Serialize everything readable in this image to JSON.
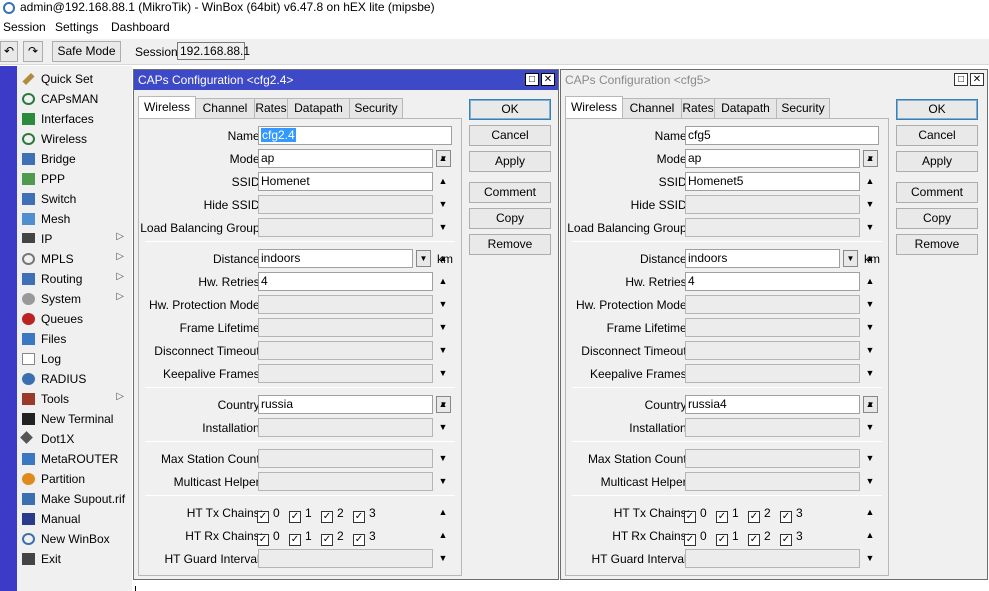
{
  "window_title": "admin@192.168.88.1 (MikroTik) - WinBox (64bit) v6.47.8 on hEX lite (mipsbe)",
  "menu": [
    "Session",
    "Settings",
    "Dashboard"
  ],
  "toolbar": {
    "undo_icon": "undo-icon",
    "redo_icon": "redo-icon",
    "safe_mode": "Safe Mode",
    "session_label": "Session:",
    "session_value": "192.168.88.1"
  },
  "sidebar": [
    {
      "label": "Quick Set",
      "icon": "quick-set-icon",
      "arrow": false
    },
    {
      "label": "CAPsMAN",
      "icon": "capsman-icon",
      "arrow": false
    },
    {
      "label": "Interfaces",
      "icon": "interfaces-icon",
      "arrow": false
    },
    {
      "label": "Wireless",
      "icon": "wireless-icon",
      "arrow": false
    },
    {
      "label": "Bridge",
      "icon": "bridge-icon",
      "arrow": false
    },
    {
      "label": "PPP",
      "icon": "ppp-icon",
      "arrow": false
    },
    {
      "label": "Switch",
      "icon": "switch-icon",
      "arrow": false
    },
    {
      "label": "Mesh",
      "icon": "mesh-icon",
      "arrow": false
    },
    {
      "label": "IP",
      "icon": "ip-icon",
      "arrow": true
    },
    {
      "label": "MPLS",
      "icon": "mpls-icon",
      "arrow": true
    },
    {
      "label": "Routing",
      "icon": "routing-icon",
      "arrow": true
    },
    {
      "label": "System",
      "icon": "system-icon",
      "arrow": true
    },
    {
      "label": "Queues",
      "icon": "queues-icon",
      "arrow": false
    },
    {
      "label": "Files",
      "icon": "files-icon",
      "arrow": false
    },
    {
      "label": "Log",
      "icon": "log-icon",
      "arrow": false
    },
    {
      "label": "RADIUS",
      "icon": "radius-icon",
      "arrow": false
    },
    {
      "label": "Tools",
      "icon": "tools-icon",
      "arrow": true
    },
    {
      "label": "New Terminal",
      "icon": "terminal-icon",
      "arrow": false
    },
    {
      "label": "Dot1X",
      "icon": "dot1x-icon",
      "arrow": false
    },
    {
      "label": "MetaROUTER",
      "icon": "metarouter-icon",
      "arrow": false
    },
    {
      "label": "Partition",
      "icon": "partition-icon",
      "arrow": false
    },
    {
      "label": "Make Supout.rif",
      "icon": "supout-icon",
      "arrow": false
    },
    {
      "label": "Manual",
      "icon": "manual-icon",
      "arrow": false
    },
    {
      "label": "New WinBox",
      "icon": "new-winbox-icon",
      "arrow": false
    },
    {
      "label": "Exit",
      "icon": "exit-icon",
      "arrow": false
    }
  ],
  "tabs": [
    "Wireless",
    "Channel",
    "Rates",
    "Datapath",
    "Security"
  ],
  "labels": {
    "name": "Name:",
    "mode": "Mode:",
    "ssid": "SSID:",
    "hide_ssid": "Hide SSID:",
    "load_balancing": "Load Balancing Group:",
    "distance": "Distance:",
    "distance_unit": "km",
    "hw_retries": "Hw. Retries:",
    "hw_protection": "Hw. Protection Mode:",
    "frame_lifetime": "Frame Lifetime:",
    "disconnect_timeout": "Disconnect Timeout:",
    "keepalive": "Keepalive Frames:",
    "country": "Country:",
    "installation": "Installation:",
    "max_station": "Max Station Count:",
    "multicast_helper": "Multicast Helper:",
    "ht_tx": "HT Tx Chains:",
    "ht_rx": "HT Rx Chains:",
    "ht_guard": "HT Guard Interval:"
  },
  "chains": [
    "0",
    "1",
    "2",
    "3"
  ],
  "buttons": [
    "OK",
    "Cancel",
    "Apply",
    "Comment",
    "Copy",
    "Remove"
  ],
  "windows": [
    {
      "title": "CAPs Configuration <cfg2.4>",
      "active": true,
      "name": "cfg2.4",
      "mode": "ap",
      "ssid": "Homenet",
      "distance": "indoors",
      "hw_retries": "4",
      "country": "russia"
    },
    {
      "title": "CAPs Configuration <cfg5>",
      "active": false,
      "name": "cfg5",
      "mode": "ap",
      "ssid": "Homenet5",
      "distance": "indoors",
      "hw_retries": "4",
      "country": "russia4"
    }
  ]
}
